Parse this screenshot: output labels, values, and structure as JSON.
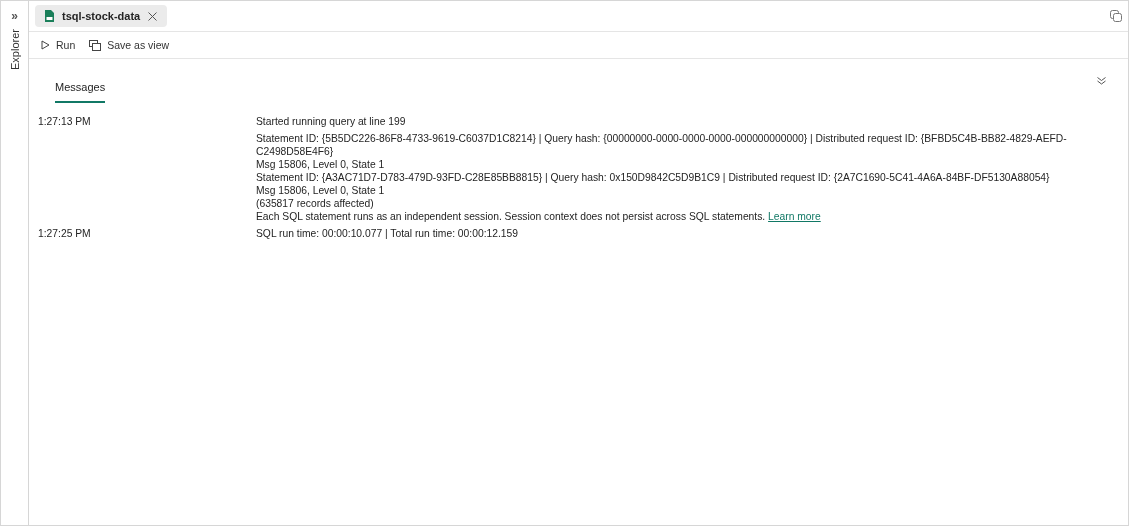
{
  "sidebar": {
    "expand_glyph": "»",
    "label": "Explorer"
  },
  "tabs": [
    {
      "label": "tsql-stock-data",
      "selected": true
    }
  ],
  "toolbar": [
    {
      "kind": "run",
      "label": "Run"
    },
    {
      "kind": "save_view",
      "label": "Save as view"
    }
  ],
  "result_tabs": [
    {
      "label": "Messages",
      "selected": true
    }
  ],
  "messages": [
    {
      "time": "1:27:13 PM",
      "lines": [
        {
          "text": "Started running query at line 199"
        },
        {
          "text": "Statement ID: {5B5DC226-86F8-4733-9619-C6037D1C8214} | Query hash: {00000000-0000-0000-0000-000000000000} | Distributed request ID: {BFBD5C4B-BB82-4829-AEFD-C2498D58E4F6}"
        },
        {
          "text": "Msg 15806, Level 0, State 1"
        },
        {
          "text": "Statement ID: {A3AC71D7-D783-479D-93FD-C28E85BB8815} | Query hash: 0x150D9842C5D9B1C9 | Distributed request ID: {2A7C1690-5C41-4A6A-84BF-DF5130A88054}"
        },
        {
          "text": "Msg 15806, Level 0, State 1"
        },
        {
          "text": "(635817 records affected)"
        },
        {
          "text": "Each SQL statement runs as an independent session. Session context does not persist across SQL statements.",
          "link": "Learn more"
        }
      ]
    },
    {
      "time": "1:27:25 PM",
      "lines": [
        {
          "text": "SQL run time: 00:00:10.077 | Total run time: 00:00:12.159"
        }
      ]
    }
  ]
}
